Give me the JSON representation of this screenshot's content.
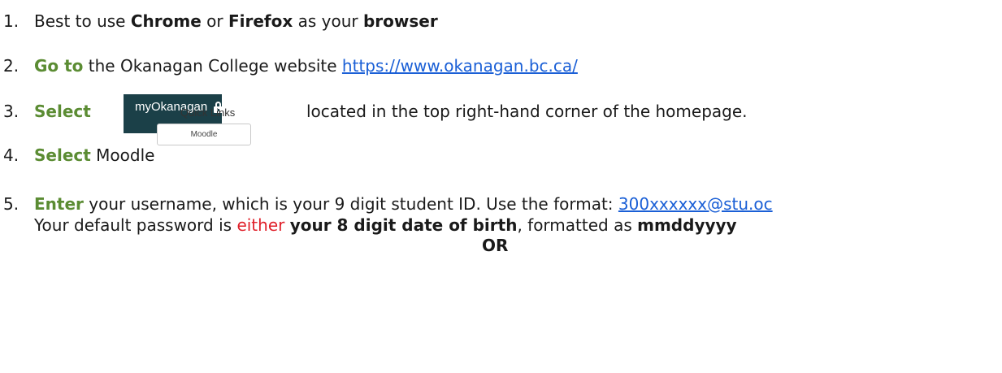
{
  "steps": [
    {
      "number": "1.",
      "t1": "Best to use ",
      "b1": "Chrome",
      "t2": " or ",
      "b2": "Firefox",
      "t3": " as your ",
      "b3": "browser"
    },
    {
      "number": "2.",
      "action": "Go to",
      "text": " the Okanagan College website ",
      "link": "https://www.okanagan.bc.ca/"
    },
    {
      "number": "3.",
      "action": "Select",
      "button_label": "myOkanagan",
      "text": "located in the top right-hand corner of the homepage."
    },
    {
      "number": "4.",
      "action": "Select",
      "text": " Moodle",
      "quick_links_label": "Quick Links",
      "moodle_button": "Moodle"
    },
    {
      "number": "5.",
      "action": "Enter",
      "text": " your username, which is your 9 digit student ID.  Use the format: ",
      "link": "300xxxxxx@stu.oc",
      "line2_t1": "Your default password is ",
      "line2_red": "either",
      "line2_sp": " ",
      "line2_b1": "your 8 digit date of birth",
      "line2_t2": ", formatted as ",
      "line2_b2": "mmddyyyy",
      "or_label": "OR"
    }
  ],
  "colors": {
    "action_green": "#5b8c33",
    "link_blue": "#1a5fd6",
    "either_red": "#e0202a",
    "button_bg": "#1b4048"
  },
  "icons": {
    "lock": "lock-icon"
  }
}
